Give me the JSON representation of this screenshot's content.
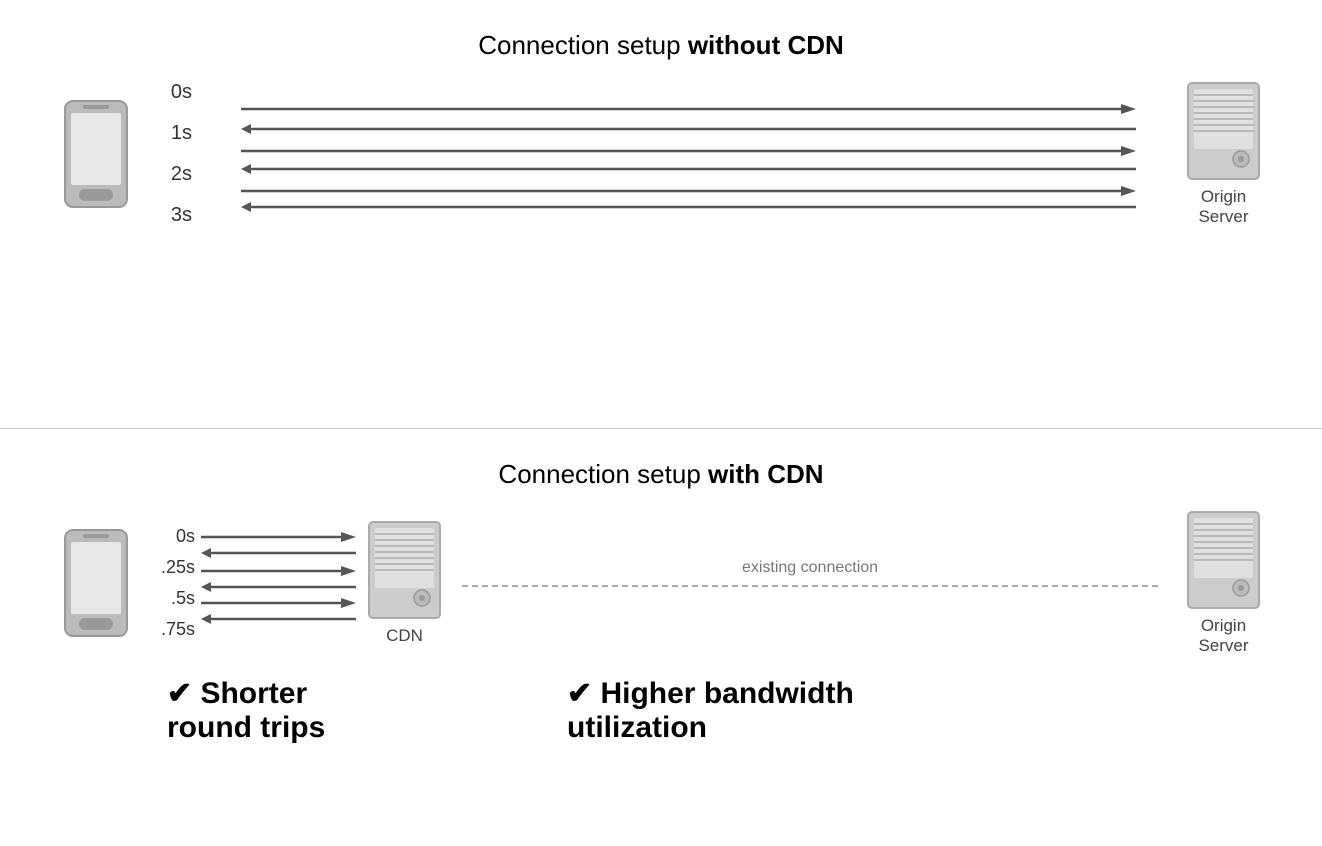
{
  "top_section": {
    "title_normal": "Connection setup ",
    "title_bold": "without CDN",
    "time_labels": [
      "0s",
      "1s",
      "2s",
      "3s"
    ],
    "server_label_line1": "Origin",
    "server_label_line2": "Server"
  },
  "bottom_section": {
    "title_normal": "Connection setup ",
    "title_bold": "with CDN",
    "time_labels": [
      "0s",
      ".25s",
      ".5s",
      ".75s"
    ],
    "cdn_label": "CDN",
    "existing_connection_label": "existing connection",
    "server_label_line1": "Origin",
    "server_label_line2": "Server",
    "benefit1_check": "✔",
    "benefit1_text": " Shorter\nround trips",
    "benefit2_check": "✔",
    "benefit2_text": " Higher bandwidth\nutilization"
  }
}
